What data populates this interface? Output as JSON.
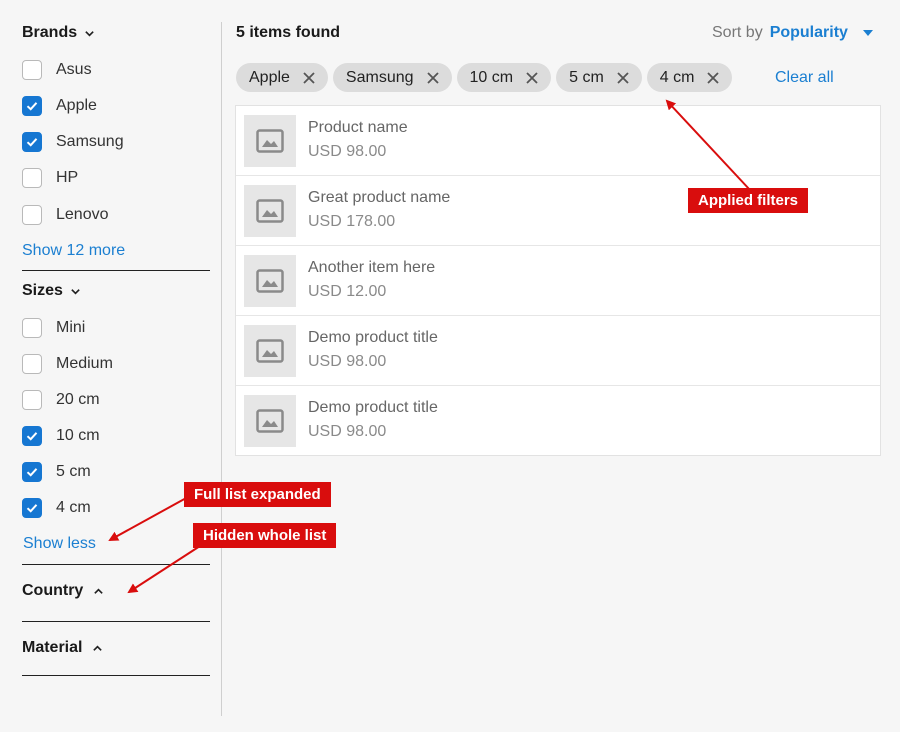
{
  "sidebar": {
    "brands": {
      "title": "Brands",
      "options": [
        {
          "label": "Asus",
          "checked": false
        },
        {
          "label": "Apple",
          "checked": true
        },
        {
          "label": "Samsung",
          "checked": true
        },
        {
          "label": "HP",
          "checked": false
        },
        {
          "label": "Lenovo",
          "checked": false
        }
      ],
      "more_link": "Show 12 more"
    },
    "sizes": {
      "title": "Sizes",
      "options": [
        {
          "label": "Mini",
          "checked": false
        },
        {
          "label": "Medium",
          "checked": false
        },
        {
          "label": "20 cm",
          "checked": false
        },
        {
          "label": "10 cm",
          "checked": true
        },
        {
          "label": "5 cm",
          "checked": true
        },
        {
          "label": "4 cm",
          "checked": true
        }
      ],
      "less_link": "Show less"
    },
    "country": {
      "title": "Country"
    },
    "material": {
      "title": "Material"
    }
  },
  "main": {
    "results_count": "5 items found",
    "sort": {
      "label": "Sort by",
      "value": "Popularity"
    },
    "applied_filters": [
      "Apple",
      "Samsung",
      "10 cm",
      "5 cm",
      "4 cm"
    ],
    "clear_all": "Clear all",
    "products": [
      {
        "name": "Product name",
        "price": "USD 98.00"
      },
      {
        "name": "Great product name",
        "price": "USD 178.00"
      },
      {
        "name": "Another item here",
        "price": "USD 12.00"
      },
      {
        "name": "Demo product title",
        "price": "USD 98.00"
      },
      {
        "name": "Demo product title",
        "price": "USD 98.00"
      }
    ]
  },
  "annotations": {
    "applied_filters": "Applied filters",
    "full_list_expanded": "Full list expanded",
    "hidden_whole_list": "Hidden whole list"
  },
  "colors": {
    "accent": "#1b7fd1",
    "checkbox_checked": "#1677d2",
    "annotation": "#d90d0d",
    "background": "#f6f6f6"
  }
}
